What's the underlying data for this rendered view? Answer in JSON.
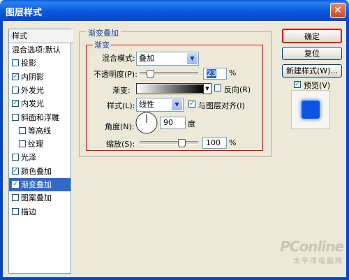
{
  "window": {
    "title": "图层样式",
    "close_glyph": "✕"
  },
  "style_list": {
    "header": "样式",
    "items": [
      {
        "label": "混合选项:默认",
        "has_checkbox": false,
        "checked": false,
        "selected": false
      },
      {
        "label": "投影",
        "has_checkbox": true,
        "checked": false,
        "selected": false
      },
      {
        "label": "内阴影",
        "has_checkbox": true,
        "checked": true,
        "selected": false
      },
      {
        "label": "外发光",
        "has_checkbox": true,
        "checked": false,
        "selected": false
      },
      {
        "label": "内发光",
        "has_checkbox": true,
        "checked": true,
        "selected": false
      },
      {
        "label": "斜面和浮雕",
        "has_checkbox": true,
        "checked": false,
        "selected": false
      },
      {
        "label": "等高线",
        "has_checkbox": true,
        "checked": false,
        "selected": false
      },
      {
        "label": "纹理",
        "has_checkbox": true,
        "checked": false,
        "selected": false
      },
      {
        "label": "光泽",
        "has_checkbox": true,
        "checked": false,
        "selected": false
      },
      {
        "label": "颜色叠加",
        "has_checkbox": true,
        "checked": true,
        "selected": false
      },
      {
        "label": "渐变叠加",
        "has_checkbox": true,
        "checked": true,
        "selected": true
      },
      {
        "label": "图案叠加",
        "has_checkbox": true,
        "checked": false,
        "selected": false
      },
      {
        "label": "描边",
        "has_checkbox": true,
        "checked": false,
        "selected": false
      }
    ]
  },
  "panel": {
    "group_title": "渐变叠加",
    "inner_title": "渐变",
    "blend_mode_label": "混合模式:",
    "blend_mode_value": "叠加",
    "opacity_label": "不透明度(P):",
    "opacity_value": "23",
    "opacity_percent": 23,
    "opacity_unit": "%",
    "gradient_label": "渐变:",
    "reverse_label": "反向(R)",
    "reverse_checked": false,
    "style_label": "样式(L):",
    "style_value": "线性",
    "align_label": "与图层对齐(I)",
    "align_checked": true,
    "angle_label": "角度(N):",
    "angle_value": "90",
    "angle_unit": "度",
    "scale_label": "缩放(S):",
    "scale_value": "100",
    "scale_percent": 100,
    "scale_unit": "%"
  },
  "buttons": {
    "ok": "确定",
    "reset": "复位",
    "new_style": "新建样式(W)...",
    "preview_label": "预览(V)",
    "preview_checked": true
  },
  "preview": {
    "swatch_color": "#0b55e0"
  },
  "watermark": {
    "line1": "PConline",
    "line2": "太平洋电脑网"
  },
  "colors": {
    "title_bar": "#0a58dc",
    "selection": "#3169c6",
    "highlight_border": "#e10000"
  }
}
